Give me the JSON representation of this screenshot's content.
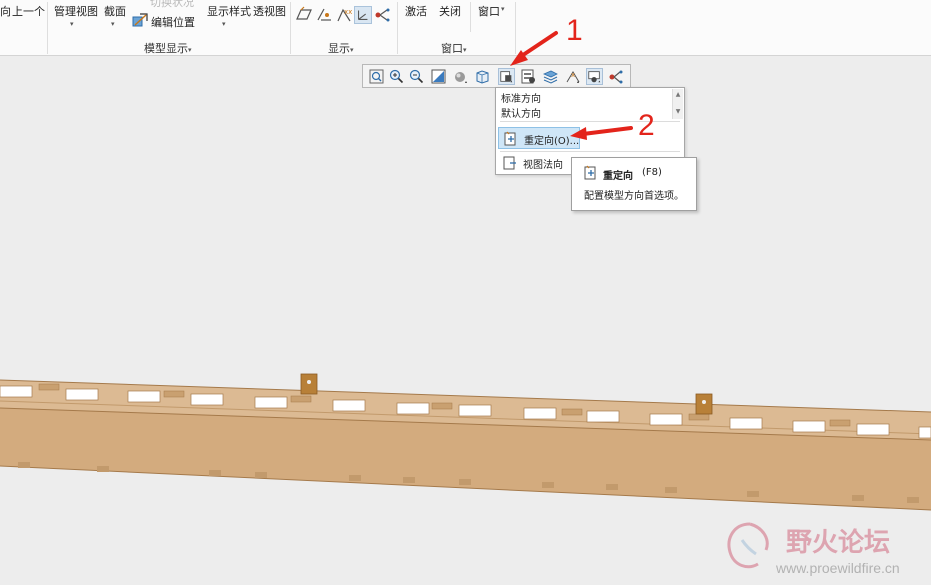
{
  "ribbon": {
    "items": {
      "prev_label": "上一个",
      "manage_view": "管理视图",
      "section": "截面",
      "toggle_status": "切换状况",
      "edit_position": "编辑位置",
      "display_style": "显示样式",
      "perspective": "透视图",
      "activate": "激活",
      "close": "关闭",
      "window": "窗口"
    },
    "groups": {
      "model_display": "模型显示",
      "show": "显示",
      "window": "窗口"
    },
    "edge_char": "向",
    "dropdown_arrow": "▾",
    "group_arrow": "▾"
  },
  "toolbar": {
    "icons": [
      "refit-icon",
      "zoom-in-icon",
      "zoom-out-icon",
      "repaint-icon",
      "display-style-icon",
      "saved-orientations-icon",
      "view-manager-icon",
      "layers-icon",
      "appearance-icon",
      "datum-display-icon",
      "annotation-display-icon",
      "spin-center-icon"
    ]
  },
  "dropdown": {
    "standard": "标准方向",
    "default": "默认方向",
    "reorient": "重定向(O)...",
    "view_normal": "视图法向",
    "scroll_up": "▲",
    "scroll_down": "▼"
  },
  "tooltip": {
    "title": "重定向",
    "shortcut": "(F8)",
    "description": "配置模型方向首选项。"
  },
  "annotations": {
    "step1": "1",
    "step2": "2"
  },
  "watermark": {
    "text": "野火论坛",
    "url": "www.proewildfire.cn"
  },
  "colors": {
    "model_top": "#d9b58e",
    "model_side": "#cfa77a",
    "model_edge": "#a57a4b",
    "accent_red": "#e3241b",
    "highlight": "#cfe6f7"
  }
}
